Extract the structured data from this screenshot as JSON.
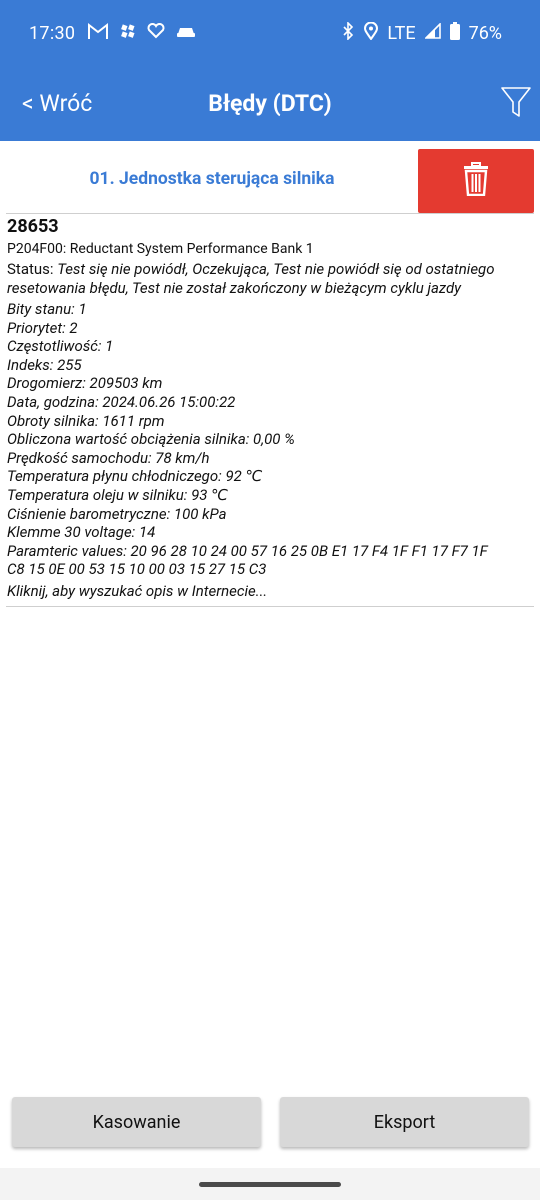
{
  "status_bar": {
    "time": "17:30",
    "left_icons": [
      "gmail-icon",
      "pinwheel-icon",
      "heart-pulse-icon",
      "car-icon"
    ],
    "network": "LTE",
    "battery": "76%"
  },
  "header": {
    "back_label": "< Wróć",
    "title": "Błędy (DTC)"
  },
  "module": {
    "title": "01. Jednostka sterująca silnika"
  },
  "dtc": {
    "code": "28653",
    "description": "P204F00: Reductant System Performance Bank 1",
    "status_label": "Status: ",
    "status_value": "Test się nie powiódł, Oczekująca, Test nie powiódł się od ostatniego resetowania błędu, Test nie został zakończony w bieżącym cyklu jazdy",
    "details": [
      "Bity stanu: 1",
      "Priorytet: 2",
      "Częstotliwość: 1",
      "Indeks: 255",
      "Drogomierz: 209503 km",
      "Data, godzina: 2024.06.26 15:00:22",
      "Obroty silnika: 1611 rpm",
      "Obliczona wartość obciążenia silnika: 0,00 %",
      "Prędkość samochodu: 78 km/h",
      "Temperatura płynu chłodniczego: 92 ℃",
      "Temperatura oleju w silniku: 93 ℃",
      "Ciśnienie barometryczne: 100 kPa",
      "Klemme 30 voltage: 14",
      "Paramteric values:  20 96 28 10 24 00 57 16 25 0B E1 17 F4 1F F1 17 F7 1F",
      "C8 15 0E 00 53 15 10 00 03 15 27 15 C3"
    ],
    "search_link": "Kliknij, aby wyszukać opis w Internecie..."
  },
  "buttons": {
    "clear": "Kasowanie",
    "export": "Eksport"
  },
  "colors": {
    "header_bg": "#3a7bd5",
    "module_title": "#3a7bd5",
    "delete_bg": "#e43a30",
    "button_bg": "#d8d8d8"
  }
}
